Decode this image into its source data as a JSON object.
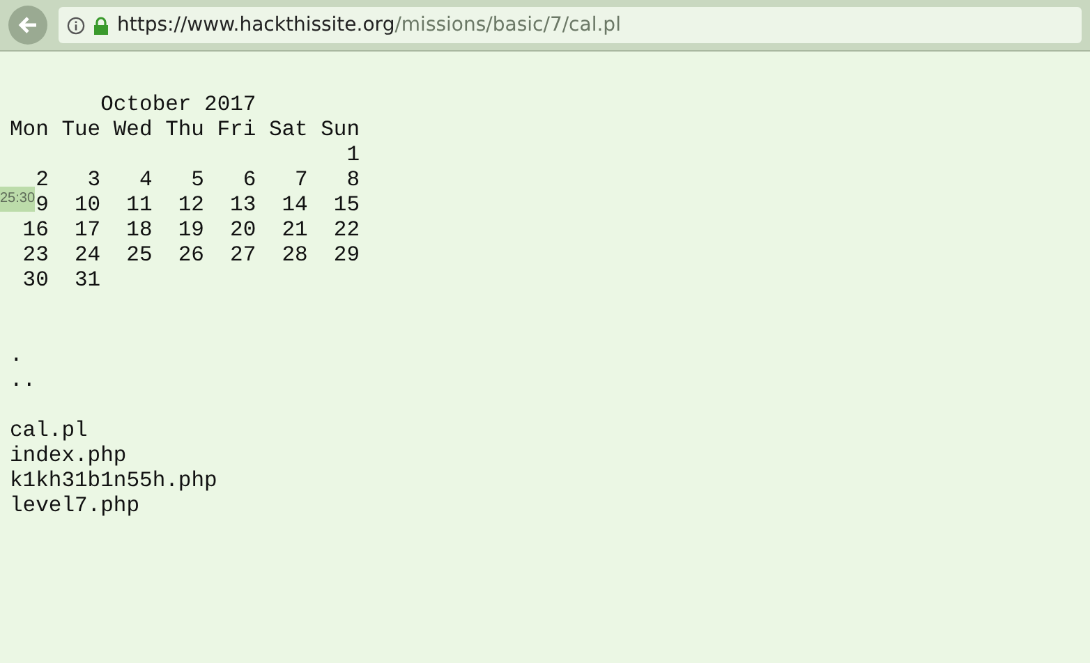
{
  "browser": {
    "url_host": "https://www.hackthissite.org",
    "url_path": "/missions/basic/7/cal.pl"
  },
  "calendar": {
    "title": "October 2017",
    "weekdays": [
      "Mon",
      "Tue",
      "Wed",
      "Thu",
      "Fri",
      "Sat",
      "Sun"
    ],
    "weeks": [
      {
        "kind": "end",
        "days": [
          "1"
        ]
      },
      {
        "kind": "full",
        "days": [
          "2",
          "3",
          "4",
          "5",
          "6",
          "7",
          "8"
        ]
      },
      {
        "kind": "full",
        "days": [
          "9",
          "10",
          "11",
          "12",
          "13",
          "14",
          "15"
        ]
      },
      {
        "kind": "full",
        "days": [
          "16",
          "17",
          "18",
          "19",
          "20",
          "21",
          "22"
        ]
      },
      {
        "kind": "full",
        "days": [
          "23",
          "24",
          "25",
          "26",
          "27",
          "28",
          "29"
        ]
      },
      {
        "kind": "start",
        "days": [
          "30",
          "31"
        ]
      }
    ]
  },
  "timer_overlay": "25:30",
  "directory_entries": [
    ".",
    ".."
  ],
  "files": [
    "cal.pl",
    "index.php",
    "k1kh31b1n55h.php",
    "level7.php"
  ]
}
